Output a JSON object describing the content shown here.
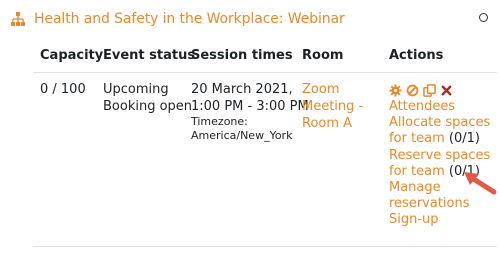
{
  "header": {
    "title": "Health and Safety in the Workplace: Webinar"
  },
  "table": {
    "columns": [
      "Capacity",
      "Event status",
      "Session times",
      "Room",
      "Actions"
    ],
    "row": {
      "capacity": "0 / 100",
      "status_line1": "Upcoming",
      "status_line2": "Booking open",
      "session_line1": "20 March 2021,",
      "session_line2": "1:00 PM - 3:00 PM",
      "tz_label": "Timezone:",
      "tz_value": "America/New_York",
      "room_line1": "Zoom",
      "room_line2": "Meeting -",
      "room_line3": "Room A"
    }
  },
  "actions": {
    "attendees": "Attendees",
    "allocate_line1": "Allocate spaces",
    "allocate_line2": "for team",
    "allocate_count": "(0/1)",
    "reserve_line1": "Reserve spaces",
    "reserve_line2": "for team",
    "reserve_count": "(0/1)",
    "manage_line1": "Manage",
    "manage_line2": "reservations",
    "signup": "Sign-up"
  },
  "icons": {
    "header": "hierarchy-icon",
    "settings": "gear-icon",
    "cancel": "ban-icon",
    "copy": "copy-icon",
    "delete": "close-icon",
    "pointer": "arrow-icon"
  },
  "colors": {
    "accent": "#e8892b",
    "text": "#1d2125",
    "delete": "#a52a2a",
    "arrow": "#e05a48"
  }
}
